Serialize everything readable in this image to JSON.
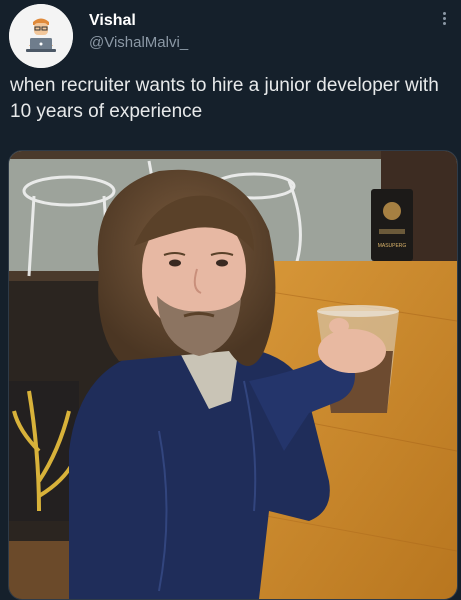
{
  "tweet": {
    "author_name": "Vishal",
    "author_handle": "@VishalMalvi_",
    "text": "when recruiter wants to hire a junior developer with 10 years of experience",
    "avatar_icon": "developer-avatar-icon",
    "more_icon": "more-options-icon"
  },
  "media": {
    "menu_sign_text": "MASUPERG"
  },
  "colors": {
    "background": "#15202b",
    "text": "#e7e9ea",
    "secondary_text": "#8b98a5",
    "table_wood": "#c98a2e",
    "jacket": "#1f2d5a"
  }
}
